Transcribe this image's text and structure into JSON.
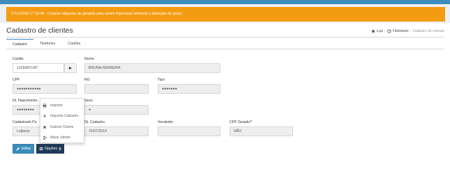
{
  "alert": {
    "text": "17/11/2022 17:16:45 - Criamos etiquetas de gondola para serem impressas referente a alteração de preço."
  },
  "header": {
    "title": "Cadastro de clientes",
    "breadcrumb": {
      "home": "Loja",
      "section": "Fidelidade",
      "current": "Cadastro de clientes"
    }
  },
  "tabs": [
    {
      "label": "Cadastro",
      "active": true
    },
    {
      "label": "Telefones",
      "active": false
    },
    {
      "label": "Cartões",
      "active": false
    }
  ],
  "form": {
    "cartao": {
      "label": "Cartão",
      "value": "1226087LMT"
    },
    "nome": {
      "label": "Nome",
      "value": "BRUNA FERREIRA"
    },
    "cpf": {
      "label": "CPF",
      "value": "●●●●●●●●●●●"
    },
    "rg": {
      "label": "RG",
      "value": ""
    },
    "tipo": {
      "label": "Tipo",
      "value": "●●●●●●●"
    },
    "dt_nascimento": {
      "label": "Dt. Nascimento",
      "value": "●●●●●●●●"
    },
    "sexo": {
      "label": "Sexo",
      "value": "●"
    },
    "cadastrado_por": {
      "label": "Cadastrado Po",
      "value": "Lojfama"
    },
    "dt_cadastro": {
      "label": "Dt. Cadastro",
      "value": "15/07/2019"
    },
    "vendedor": {
      "label": "Vendedor",
      "value": ""
    },
    "cpf_gerado": {
      "label": "CPF Gerado?",
      "value": "NÃO"
    }
  },
  "menu": {
    "items": [
      {
        "label": "Imprimir",
        "icon": "printer-icon"
      },
      {
        "label": "Importar Cadastro",
        "icon": "import-icon"
      },
      {
        "label": "Inativar Cliente",
        "icon": "close-icon"
      },
      {
        "label": "Ativar cliente",
        "icon": "user-plus-icon"
      }
    ]
  },
  "buttons": {
    "editar": "Editar",
    "opcoes": "Opções"
  },
  "colors": {
    "alert": "#f39c12",
    "primary": "#3c8dbc",
    "dark": "#1f3a55"
  }
}
